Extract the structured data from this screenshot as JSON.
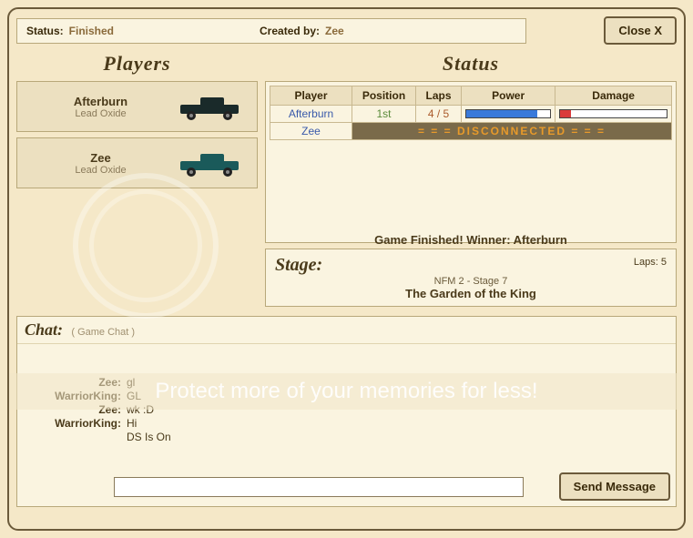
{
  "topbar": {
    "status_label": "Status:",
    "status_value": "Finished",
    "created_label": "Created by:",
    "created_value": "Zee",
    "close_label": "Close X"
  },
  "headers": {
    "players": "Players",
    "status": "Status"
  },
  "players": [
    {
      "name": "Afterburn",
      "car": "Lead Oxide",
      "car_color": "#1a2a2a"
    },
    {
      "name": "Zee",
      "car": "Lead Oxide",
      "car_color": "#1a5a5a"
    }
  ],
  "status_table": {
    "cols": {
      "player": "Player",
      "position": "Position",
      "laps": "Laps",
      "power": "Power",
      "damage": "Damage"
    },
    "rows": [
      {
        "player": "Afterburn",
        "position": "1st",
        "laps": "4 / 5",
        "power_pct": 85,
        "damage_pct": 10
      },
      {
        "player": "Zee",
        "disconnected": "=  =  =  DISCONNECTED  =  =  ="
      }
    ]
  },
  "finished": {
    "text": "Game Finished!   Winner:  Afterburn"
  },
  "stage": {
    "label": "Stage:",
    "sub": "NFM 2 - Stage 7",
    "name": "The Garden of the King",
    "laps": "Laps: 5"
  },
  "chat": {
    "title": "Chat:",
    "subtitle": "( Game Chat )",
    "lines": [
      {
        "name": "Zee:",
        "msg": "gl"
      },
      {
        "name": "WarriorKing:",
        "msg": "GL"
      },
      {
        "name": "Zee:",
        "msg": "wk :D"
      },
      {
        "name": "WarriorKing:",
        "msg": "Hi"
      },
      {
        "name": "",
        "msg": "DS Is On"
      }
    ],
    "send_label": "Send Message",
    "input_value": ""
  },
  "watermark": "Protect more of your memories for less!"
}
